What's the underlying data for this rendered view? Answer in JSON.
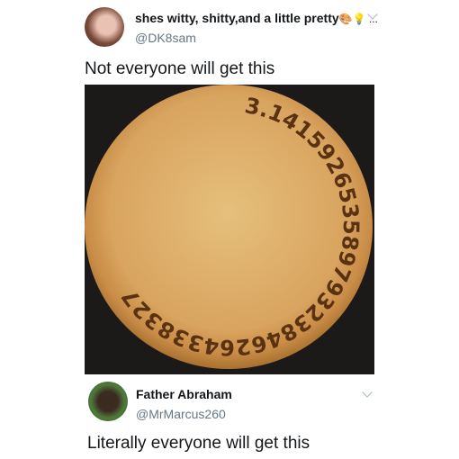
{
  "tweet": {
    "author_name": "shes witty, shitty,and a little pretty",
    "name_emojis": "🎨💡 ...",
    "handle": "@DK8sam",
    "text": "Not everyone will get this",
    "image": {
      "pie_digits": "3.14159265358979323846264338327"
    }
  },
  "reply": {
    "author_name": "Father Abraham",
    "handle": "@MrMarcus260",
    "text": "Literally everyone will get this"
  }
}
